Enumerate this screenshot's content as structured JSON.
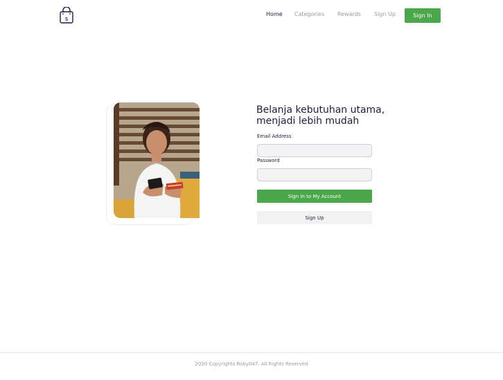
{
  "header": {
    "logo_icon": "shopping-bag-icon",
    "nav": [
      {
        "label": "Home",
        "active": true
      },
      {
        "label": "Categories",
        "active": false
      },
      {
        "label": "Rewards",
        "active": false
      },
      {
        "label": "Sign Up",
        "active": false
      }
    ],
    "signin_label": "Sign In"
  },
  "hero": {
    "headline_line1": "Belanja kebutuhan utama,",
    "headline_line2": "menjadi lebih mudah",
    "image": "woman-shopping-online-photo"
  },
  "form": {
    "email_label": "Email Address",
    "email_value": "",
    "password_label": "Password",
    "password_value": "",
    "submit_label": "Sign In to My Account",
    "signup_label": "Sign Up"
  },
  "footer": {
    "copyright": "2020 Copyrights Roby047. All Rights Reserved"
  },
  "colors": {
    "accent": "#4aa74a",
    "text_dark": "#1d1d3b",
    "muted": "#9a9aa5"
  }
}
